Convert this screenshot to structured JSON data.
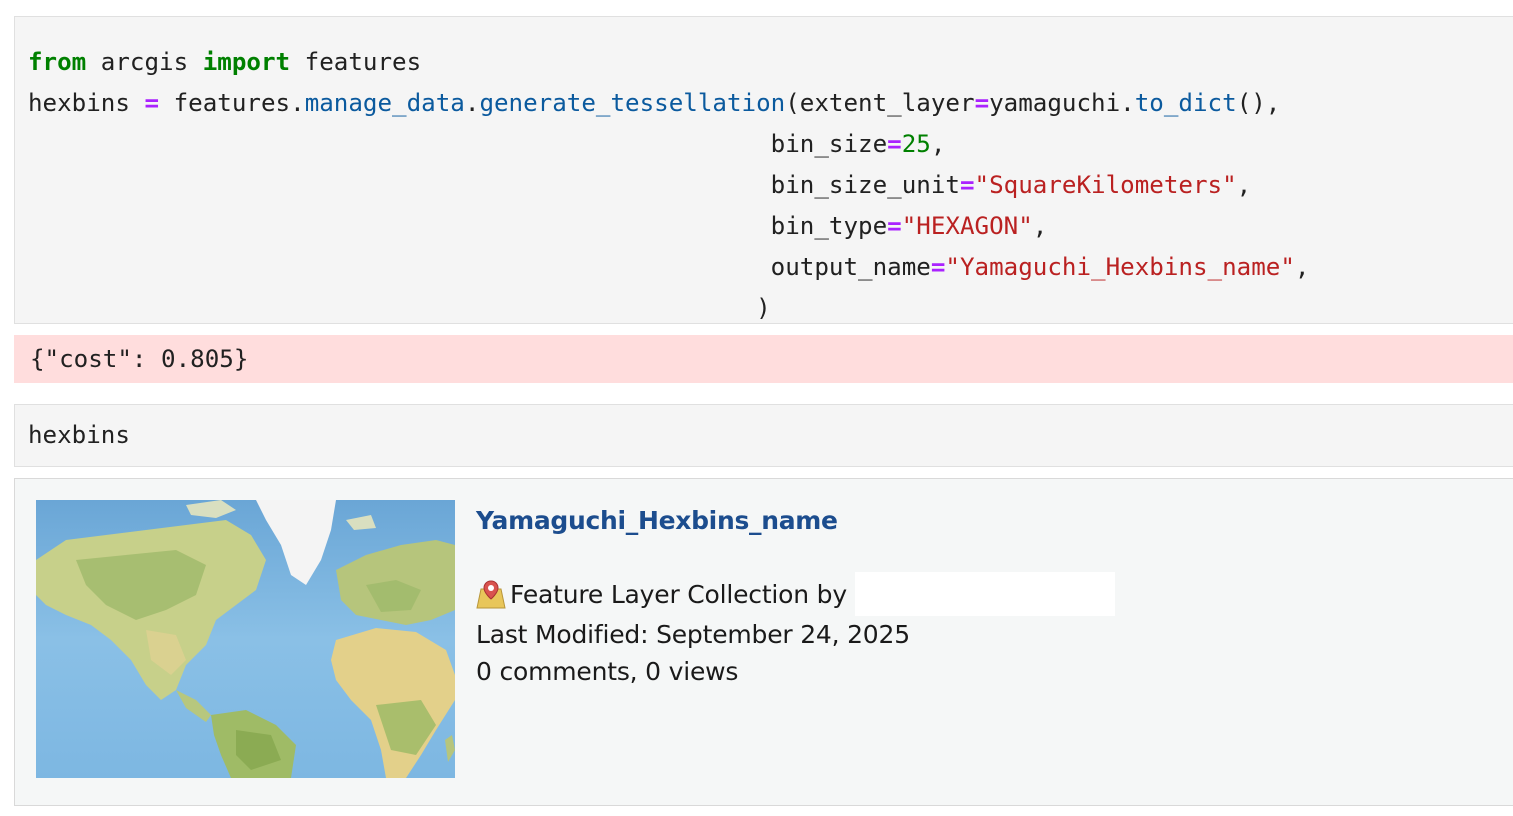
{
  "cell1": {
    "line1": {
      "kw_from": "from",
      "mod": " arcgis ",
      "kw_import": "import",
      "name": " features"
    },
    "line2": {
      "var": "hexbins ",
      "eq": "=",
      "obj": " features.",
      "method1": "manage_data",
      "dot": ".",
      "method2": "generate_tessellation",
      "arg1_open": "(extent_layer",
      "arg1_eq": "=",
      "arg1_val": "yamaguchi.",
      "arg1_call": "to_dict",
      "arg1_end": "(),"
    },
    "line3": {
      "param": "bin_size",
      "eq": "=",
      "val": "25",
      "end": ","
    },
    "line4": {
      "param": "bin_size_unit",
      "eq": "=",
      "val": "\"SquareKilometers\"",
      "end": ","
    },
    "line5": {
      "param": "bin_type",
      "eq": "=",
      "val": "\"HEXAGON\"",
      "end": ","
    },
    "line6": {
      "param": "output_name",
      "eq": "=",
      "val": "\"Yamaguchi_Hexbins_name\"",
      "end": ","
    },
    "line7": {
      "close": ")"
    }
  },
  "stderr_output": "{\"cost\": 0.805}",
  "cell2": {
    "code": "hexbins"
  },
  "result_item": {
    "title": "Yamaguchi_Hexbins_name",
    "type_line": "Feature Layer Collection by",
    "type_icon": "feature-layer-collection-icon",
    "modified": "Last Modified: September 24, 2025",
    "stats": "0 comments, 0 views"
  },
  "colors": {
    "keyword": "#008000",
    "operator": "#aa22ff",
    "function": "#0b5a9e",
    "string": "#ba2121",
    "title_link": "#1c4d8e",
    "stderr_bg": "#ffdddd"
  }
}
